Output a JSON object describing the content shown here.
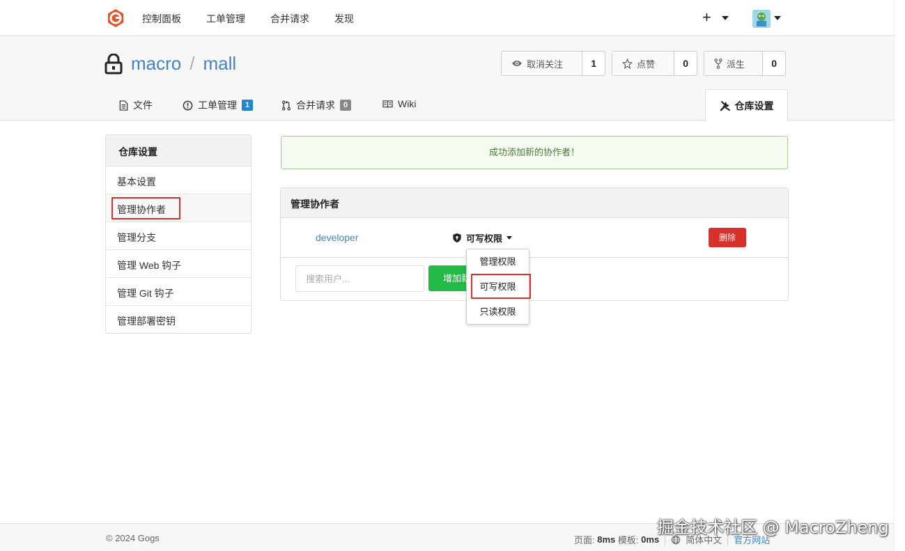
{
  "topnav": {
    "items": [
      "控制面板",
      "工单管理",
      "合并请求",
      "发现"
    ],
    "plus": "+"
  },
  "repo": {
    "owner": "macro",
    "separator": "/",
    "name": "mall"
  },
  "stats": {
    "watch_label": "取消关注",
    "watch_count": "1",
    "star_label": "点赞",
    "star_count": "0",
    "fork_label": "派生",
    "fork_count": "0"
  },
  "tabs": {
    "files": "文件",
    "issues": "工单管理",
    "issues_count": "1",
    "pulls": "合并请求",
    "pulls_count": "0",
    "wiki": "Wiki",
    "settings": "仓库设置"
  },
  "sidebar": {
    "header": "仓库设置",
    "items": [
      "基本设置",
      "管理协作者",
      "管理分支",
      "管理 Web 钩子",
      "管理 Git 钩子",
      "管理部署密钥"
    ]
  },
  "flash": "成功添加新的协作者！",
  "collaborators": {
    "header": "管理协作者",
    "rows": [
      {
        "name": "developer",
        "permission": "可写权限",
        "delete_label": "删除"
      }
    ],
    "search_placeholder": "搜索用户...",
    "add_label": "增加新的协作者"
  },
  "permission_menu": [
    "管理权限",
    "可写权限",
    "只读权限"
  ],
  "footer": {
    "copyright": "© 2024 Gogs",
    "page_label": "页面:",
    "page_time": "8ms",
    "template_label": "模板:",
    "template_time": "0ms",
    "language": "简体中文",
    "website": "官方网站"
  },
  "watermark": "掘金技术社区 @ MacroZheng",
  "colors": {
    "brand_logo": "#e3542b",
    "link": "#4183c4",
    "delete": "#d9302c",
    "add": "#21ba45",
    "issues_badge": "#2185d0",
    "pulls_badge": "#888888",
    "highlight": "#d9302c"
  }
}
